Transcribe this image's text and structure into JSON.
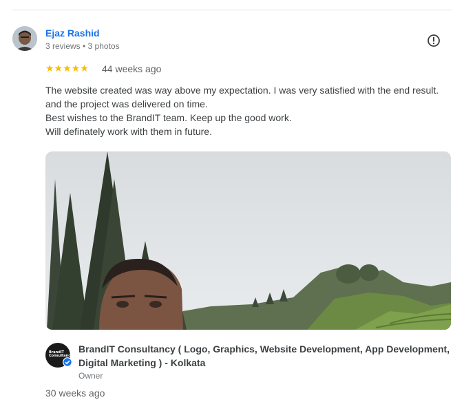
{
  "review": {
    "reviewer_name": "Ejaz Rashid",
    "reviewer_meta": "3 reviews • 3 photos",
    "rating": 5,
    "stars": "★★★★★",
    "date": "44 weeks ago",
    "text_lines": [
      "The website created was way above my expectation. I was very satisfied with the end result.",
      "and the project was delivered on time.",
      "Best wishes to the BrandIT team. Keep up the good work.",
      "Will definately work with them in future."
    ],
    "report_icon": "report-flag-icon",
    "photo_icon": "review-photo"
  },
  "owner_reply": {
    "logo_text": "BrandIT Consultancy",
    "name_lines": [
      "BrandIT Consultancy ( Logo, Graphics, Website Development, App Development,",
      "Digital Marketing ) - Kolkata"
    ],
    "role": "Owner",
    "date": "30 weeks ago",
    "verified_icon": "verified-check-icon"
  },
  "colors": {
    "name_link": "#1a73e8",
    "star": "#fbbc04",
    "meta": "#70757a",
    "body_text": "#3c4043",
    "verified": "#1a73e8"
  }
}
